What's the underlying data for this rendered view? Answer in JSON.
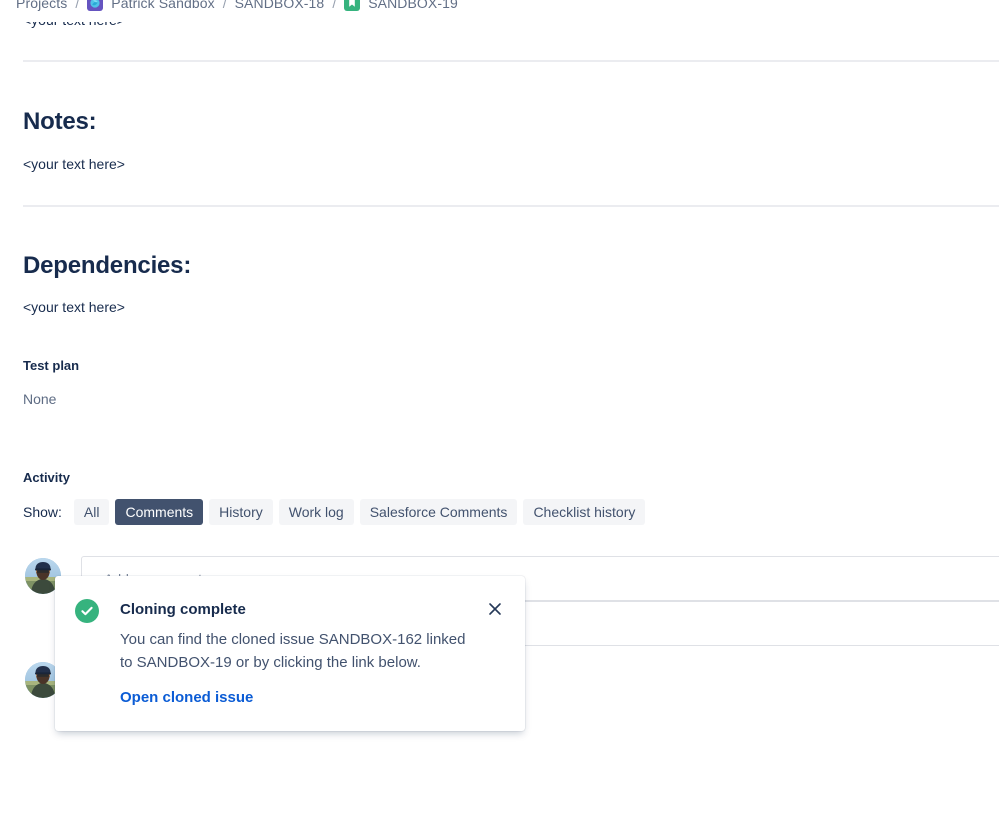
{
  "breadcrumb": {
    "items": [
      {
        "label": "Projects",
        "icon": null
      },
      {
        "label": "Patrick Sandbox",
        "icon": "project-avatar-icon"
      },
      {
        "label": "SANDBOX-18",
        "icon": null
      },
      {
        "label": "SANDBOX-19",
        "icon": "task-type-icon"
      }
    ],
    "separator": "/"
  },
  "content": {
    "clipped_text": "<your text here>",
    "notes": {
      "heading": "Notes:",
      "text": "<your text here>"
    },
    "dependencies": {
      "heading": "Dependencies:",
      "text": "<your text here>"
    },
    "test_plan": {
      "label": "Test plan",
      "value": "None"
    }
  },
  "activity": {
    "title": "Activity",
    "show_label": "Show:",
    "tabs": [
      {
        "label": "All",
        "selected": false
      },
      {
        "label": "Comments",
        "selected": true
      },
      {
        "label": "History",
        "selected": false
      },
      {
        "label": "Work log",
        "selected": false
      },
      {
        "label": "Salesforce Comments",
        "selected": false
      },
      {
        "label": "Checklist history",
        "selected": false
      }
    ]
  },
  "comment": {
    "placeholder": "Add a comment..."
  },
  "flag": {
    "icon": "success-check-icon",
    "title": "Cloning complete",
    "message": "You can find the cloned issue SANDBOX-162 linked to SANDBOX-19 or by clicking the link below.",
    "action_label": "Open cloned issue",
    "close_label": "Dismiss"
  },
  "colors": {
    "success_green": "#36B37E",
    "link_blue": "#0B5CD5",
    "text_primary": "#172B4D",
    "text_subtle": "#626F86",
    "tab_selected_bg": "#42526E",
    "tab_bg": "#F4F5F7",
    "project_icon_bg": "#6554C0"
  }
}
